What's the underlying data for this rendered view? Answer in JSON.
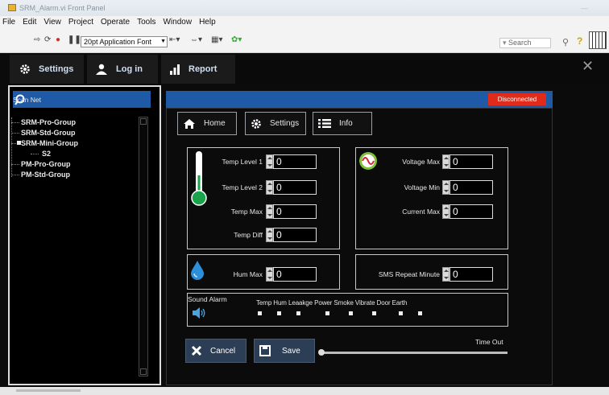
{
  "window": {
    "title": "SRM_Alarm.vi Front Panel"
  },
  "menubar": [
    "File",
    "Edit",
    "View",
    "Project",
    "Operate",
    "Tools",
    "Window",
    "Help"
  ],
  "toolbar": {
    "font": "20pt Application Font",
    "search_placeholder": "Search"
  },
  "nav": {
    "settings": "Settings",
    "login": "Log in",
    "report": "Report"
  },
  "left": {
    "scan_label": "Scan Net",
    "tree": [
      "SRM-Pro-Group",
      "SRM-Std-Group",
      "SRM-Mini-Group",
      "S2",
      "PM-Pro-Group",
      "PM-Std-Group"
    ]
  },
  "status": {
    "connection": "Disconnected",
    "color": "#e02b1b"
  },
  "tabs": {
    "home": "Home",
    "settings": "Settings",
    "info": "Info"
  },
  "temp": {
    "level1_label": "Temp Level 1",
    "level1": "0",
    "level2_label": "Temp Level 2",
    "level2": "0",
    "max_label": "Temp Max",
    "max": "0",
    "diff_label": "Temp Diff",
    "diff": "0"
  },
  "voltage": {
    "vmax_label": "Voltage Max",
    "vmax": "0",
    "vmin_label": "Voltage Min",
    "vmin": "0",
    "cmax_label": "Current Max",
    "cmax": "0"
  },
  "hum": {
    "label": "Hum Max",
    "value": "0"
  },
  "sms": {
    "label": "SMS Repeat Minute",
    "value": "0"
  },
  "alarm": {
    "title": "Sound Alarm",
    "items": "Temp Hum Leaakge Power Smoke Vibrate Door Earth"
  },
  "actions": {
    "cancel": "Cancel",
    "save": "Save",
    "timeout_label": "Time Out"
  },
  "colors": {
    "accent_blue": "#1f5aa6",
    "panel_bg": "#0b0b0b"
  }
}
